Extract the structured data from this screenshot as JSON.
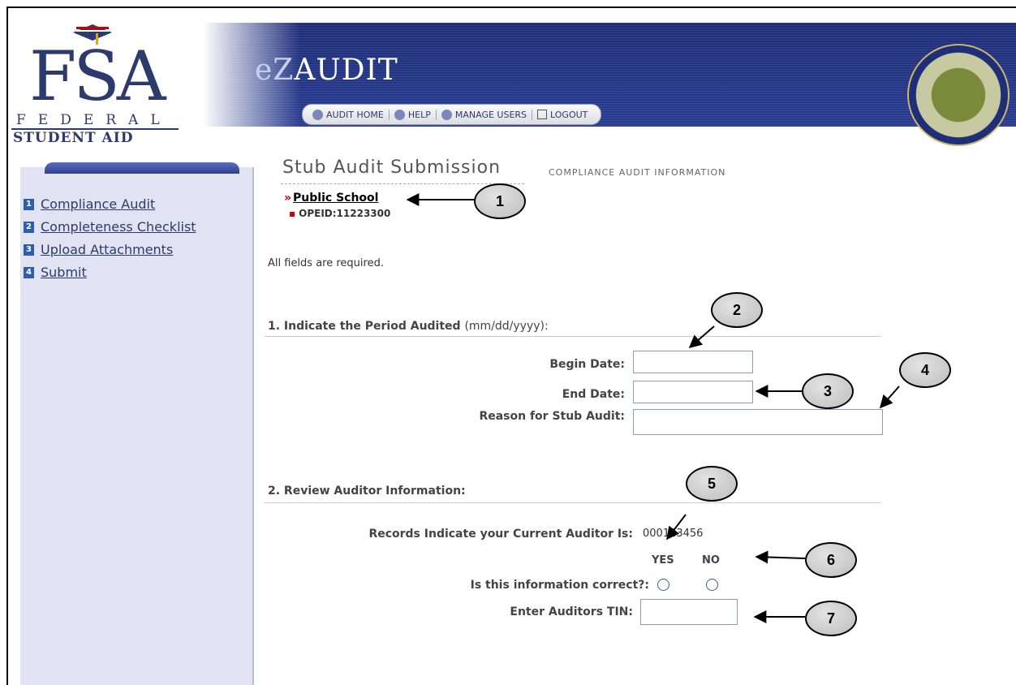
{
  "header": {
    "fsa_letters": "FSA",
    "fsa_line1": "FEDERAL",
    "fsa_line2": "STUDENT AID",
    "app_prefix": "eZ",
    "app_name": "AUDIT",
    "nav": [
      {
        "label": "AUDIT HOME",
        "icon": "ez-icon"
      },
      {
        "label": "HELP",
        "icon": "help-icon"
      },
      {
        "label": "MANAGE USERS",
        "icon": "users-icon"
      },
      {
        "label": "LOGOUT",
        "icon": "close-box-icon"
      }
    ],
    "seal_icon": "department-of-education-seal"
  },
  "sidebar": {
    "items": [
      {
        "num": "1",
        "label": "Compliance Audit"
      },
      {
        "num": "2",
        "label": "Completeness Checklist"
      },
      {
        "num": "3",
        "label": "Upload Attachments"
      },
      {
        "num": "4",
        "label": "Submit"
      }
    ]
  },
  "main": {
    "title": "Stub Audit Submission",
    "subtitle": "COMPLIANCE AUDIT INFORMATION",
    "school_marker": "»",
    "school_name": "Public School",
    "opeid_marker": "▪",
    "opeid": "OPEID:11223300",
    "required_note": "All fields are required.",
    "section1": {
      "title": "1. Indicate the Period Audited",
      "format": "(mm/dd/yyyy):",
      "begin_label": "Begin Date:",
      "begin_value": "",
      "end_label": "End Date:",
      "end_value": "",
      "reason_label": "Reason for Stub Audit:",
      "reason_value": ""
    },
    "section2": {
      "title": "2. Review Auditor Information:",
      "auditor_label": "Records Indicate your Current Auditor Is:",
      "auditor_value": "000123456",
      "yes_label": "YES",
      "no_label": "NO",
      "correct_label": "Is this information correct?:",
      "tin_label": "Enter Auditors TIN:",
      "tin_value": ""
    }
  },
  "callouts": [
    "1",
    "2",
    "3",
    "4",
    "5",
    "6",
    "7"
  ],
  "colors": {
    "banner": "#26388a",
    "sidebar": "#e1e3f2",
    "accent_red": "#cc0000",
    "link": "#2c3b6b"
  }
}
